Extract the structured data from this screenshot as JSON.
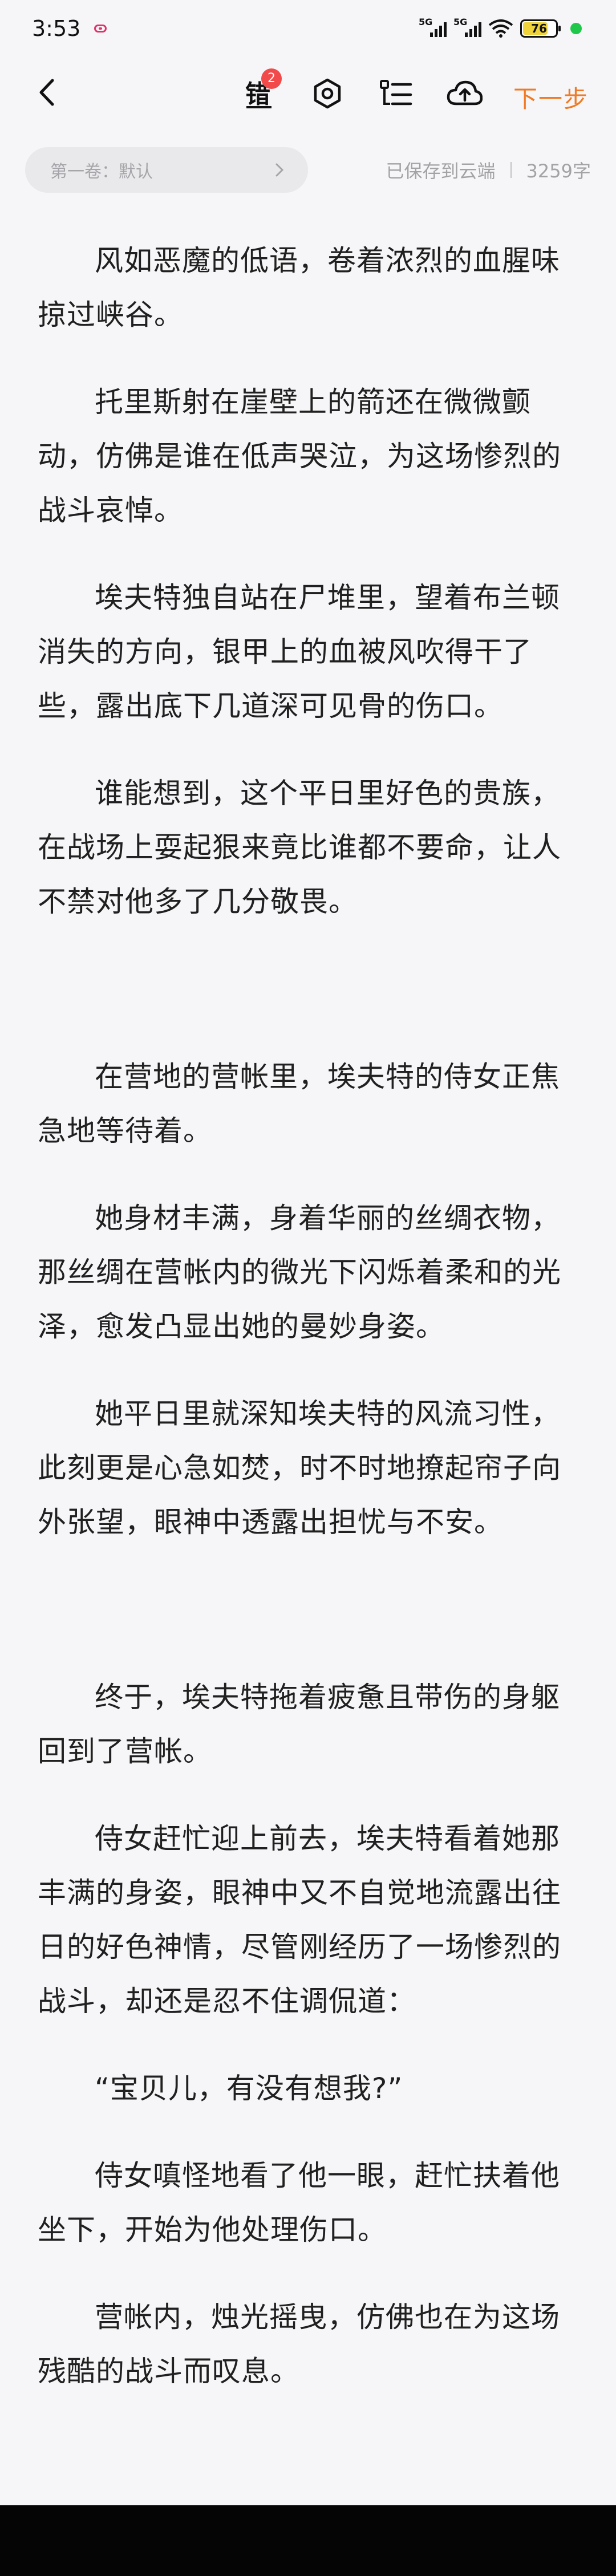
{
  "status_bar": {
    "time": "3:53",
    "network_1": "5G",
    "network_2": "5G",
    "battery_level": "76",
    "battery_fill_fraction": 0.76,
    "colors": {
      "notification": "#e3326a",
      "battery_fill": "#f0d23a",
      "active_dot": "#1fc84a"
    }
  },
  "toolbar": {
    "back_icon": "chevron-left-icon",
    "typo_badge_count": "2",
    "next_label": "下一步",
    "icons": [
      "typo-check-icon",
      "settings-hexagon-icon",
      "outline-list-icon",
      "cloud-upload-icon"
    ],
    "accent_color": "#f07a25"
  },
  "info": {
    "volume_label": "第一卷：默认",
    "save_status": "已保存到云端",
    "word_count": "3259字"
  },
  "chapter": {
    "paragraphs": [
      "风如恶魔的低语，卷着浓烈的血腥味掠过峡谷。",
      "托里斯射在崖壁上的箭还在微微颤动，仿佛是谁在低声哭泣，为这场惨烈的战斗哀悼。",
      "埃夫特独自站在尸堆里，望着布兰顿消失的方向，银甲上的血被风吹得干了些，露出底下几道深可见骨的伤口。",
      "谁能想到，这个平日里好色的贵族，在战场上耍起狠来竟比谁都不要命，让人不禁对他多了几分敬畏。",
      "在营地的营帐里，埃夫特的侍女正焦急地等待着。",
      "她身材丰满，身着华丽的丝绸衣物，那丝绸在营帐内的微光下闪烁着柔和的光泽，愈发凸显出她的曼妙身姿。",
      "她平日里就深知埃夫特的风流习性，此刻更是心急如焚，时不时地撩起帘子向外张望，眼神中透露出担忧与不安。",
      "终于，埃夫特拖着疲惫且带伤的身躯回到了营帐。",
      "侍女赶忙迎上前去，埃夫特看着她那丰满的身姿，眼神中又不自觉地流露出往日的好色神情，尽管刚经历了一场惨烈的战斗，却还是忍不住调侃道：",
      "“宝贝儿，有没有想我?”",
      "侍女嗔怪地看了他一眼，赶忙扶着他坐下，开始为他处理伤口。",
      "营帐内，烛光摇曳，仿佛也在为这场残酷的战斗而叹息。"
    ]
  }
}
